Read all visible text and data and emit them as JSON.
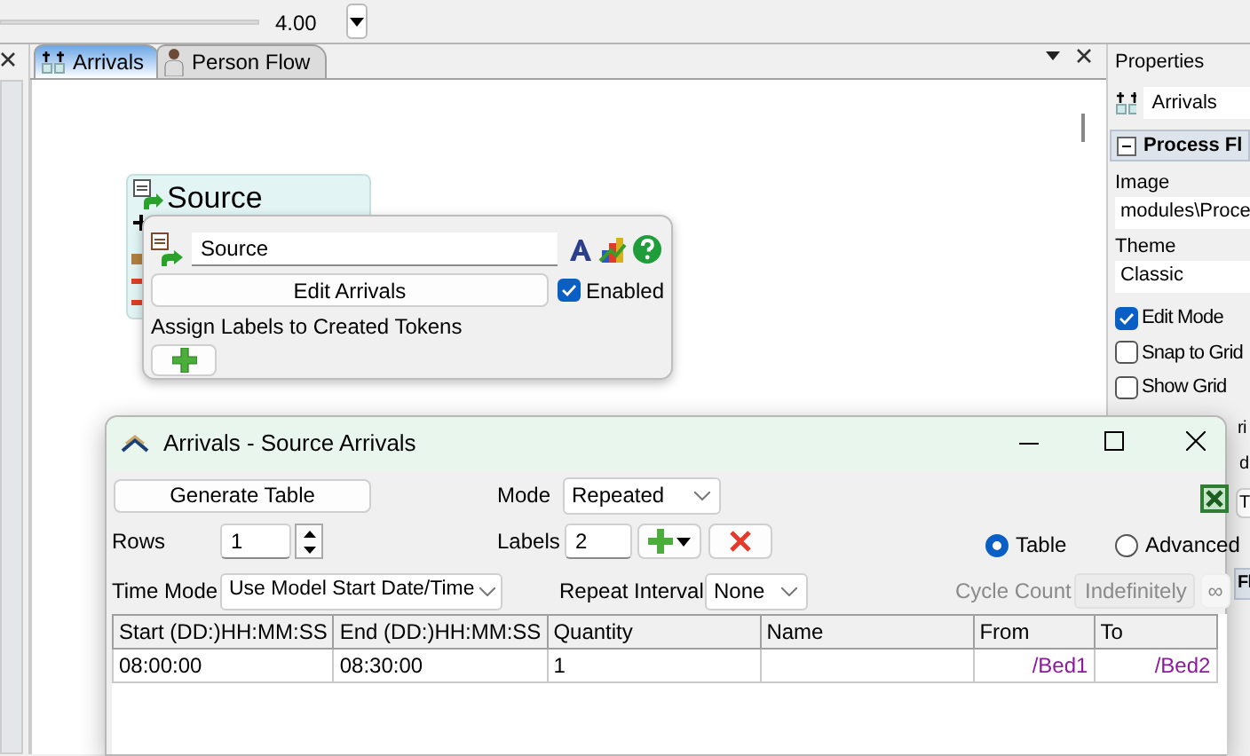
{
  "toolbar": {
    "zoom_value": "4.00"
  },
  "tabs": [
    {
      "label": "Arrivals",
      "selected": true
    },
    {
      "label": "Person Flow",
      "selected": false
    }
  ],
  "canvas": {
    "node": {
      "title": "Source"
    }
  },
  "popup": {
    "name": "Source",
    "button": "Edit Arrivals",
    "enabled": {
      "label": "Enabled",
      "checked": true
    },
    "labels_heading": "Assign Labels to Created Tokens"
  },
  "dialog": {
    "title": "Arrivals - Source Arrivals",
    "generate_button": "Generate Table",
    "mode": {
      "label": "Mode",
      "value": "Repeated"
    },
    "rows": {
      "label": "Rows",
      "value": "1"
    },
    "labels": {
      "label": "Labels",
      "value": "2"
    },
    "view": [
      {
        "label": "Table",
        "selected": true
      },
      {
        "label": "Advanced",
        "selected": false
      }
    ],
    "time_mode": {
      "label": "Time Mode",
      "value": "Use Model Start Date/Time"
    },
    "repeat_interval": {
      "label": "Repeat Interval",
      "value": "None"
    },
    "cycle_count": {
      "label": "Cycle Count",
      "value": "Indefinitely",
      "disabled": true
    },
    "infinity_button": "∞",
    "table": {
      "columns": [
        "Start (DD:)HH:MM:SS",
        "End (DD:)HH:MM:SS",
        "Quantity",
        "Name",
        "From",
        "To"
      ],
      "rows": [
        [
          "08:00:00",
          "08:30:00",
          "1",
          null,
          "/Bed1",
          "/Bed2"
        ]
      ]
    }
  },
  "properties": {
    "title": "Properties",
    "object": "Arrivals",
    "section": "Process Fl",
    "image": {
      "label": "Image",
      "value": "modules\\Proce"
    },
    "theme": {
      "label": "Theme",
      "value": "Classic"
    },
    "options": [
      {
        "label": "Edit Mode",
        "checked": true
      },
      {
        "label": "Snap to Grid",
        "checked": false
      },
      {
        "label": "Show Grid",
        "checked": false
      }
    ],
    "partial_texts": [
      "ri",
      "d"
    ],
    "partial_button": "T",
    "partial_section": "Fl"
  }
}
